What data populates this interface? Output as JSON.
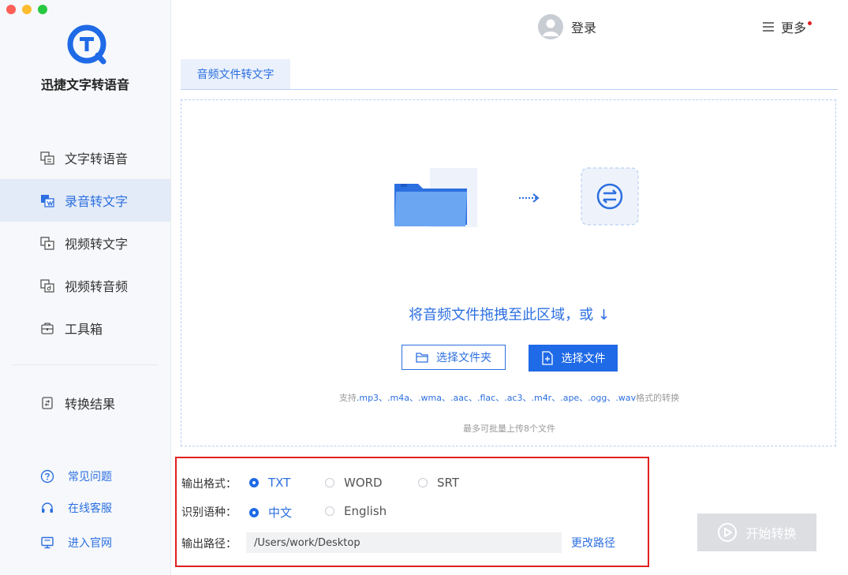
{
  "app": {
    "name": "迅捷文字转语音"
  },
  "sidebar": {
    "items": [
      {
        "label": "文字转语音",
        "icon": "text-to-speech-icon"
      },
      {
        "label": "录音转文字",
        "icon": "recording-to-text-icon"
      },
      {
        "label": "视频转文字",
        "icon": "video-to-text-icon"
      },
      {
        "label": "视频转音频",
        "icon": "video-to-audio-icon"
      },
      {
        "label": "工具箱",
        "icon": "toolbox-icon"
      },
      {
        "label": "转换结果",
        "icon": "result-icon"
      }
    ],
    "active_index": 1,
    "help": [
      {
        "label": "常见问题",
        "icon": "question-icon"
      },
      {
        "label": "在线客服",
        "icon": "headset-icon"
      },
      {
        "label": "进入官网",
        "icon": "monitor-icon"
      }
    ]
  },
  "header": {
    "login_label": "登录",
    "more_label": "更多"
  },
  "tabs": [
    {
      "label": "音频文件转文字"
    }
  ],
  "dropzone": {
    "instruction": "将音频文件拖拽至此区域，或 ↓",
    "select_folder": "选择文件夹",
    "select_file": "选择文件",
    "formats_prefix": "支持",
    "formats": ".mp3、.m4a、.wma、.aac、.flac、.ac3、.m4r、.ape、.ogg、.wav",
    "formats_suffix": "格式的转换",
    "limit": "最多可批量上传8个文件"
  },
  "options": {
    "format_label": "输出格式：",
    "formats": [
      "TXT",
      "WORD",
      "SRT"
    ],
    "format_selected": "TXT",
    "language_label": "识别语种：",
    "languages": [
      "中文",
      "English"
    ],
    "language_selected": "中文",
    "path_label": "输出路径：",
    "path_value": "/Users/work/Desktop",
    "change_path": "更改路径"
  },
  "start_button": "开始转换",
  "colors": {
    "accent": "#1f6ae6",
    "highlight_box": "#e0201f",
    "disabled": "#dcdee2"
  }
}
